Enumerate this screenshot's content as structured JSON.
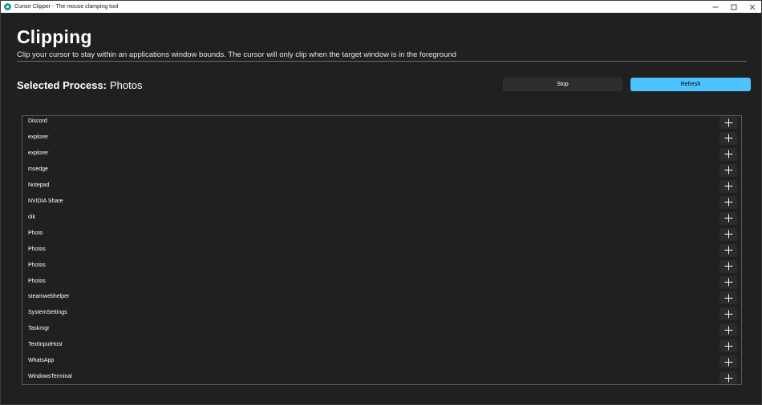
{
  "window": {
    "title": "Cursor Clipper - The mouse clamping tool"
  },
  "page": {
    "heading": "Clipping",
    "subheading": "Clip your cursor to stay within an applications window bounds. The cursor will only clip when the target window is in the foreground"
  },
  "selection": {
    "label": "Selected Process:",
    "value": "Photos"
  },
  "actions": {
    "stop_label": "Stop",
    "refresh_label": "Refresh"
  },
  "processes": [
    "Discord",
    "explorer",
    "explorer",
    "msedge",
    "Notepad",
    "NVIDIA Share",
    "olk",
    "Photo",
    "Photos",
    "Photos",
    "Photos",
    "steamwebhelper",
    "SystemSettings",
    "Taskmgr",
    "TextInputHost",
    "WhatsApp",
    "WindowsTerminal"
  ],
  "icons": {
    "add": "plus-icon",
    "minimize": "minimize-icon",
    "maximize": "maximize-icon",
    "close": "close-icon",
    "app": "app-logo-icon"
  },
  "colors": {
    "accent": "#4cc2ff",
    "background": "#202020",
    "titlebar": "#ffffff",
    "app_icon": "#1e9b8f"
  }
}
